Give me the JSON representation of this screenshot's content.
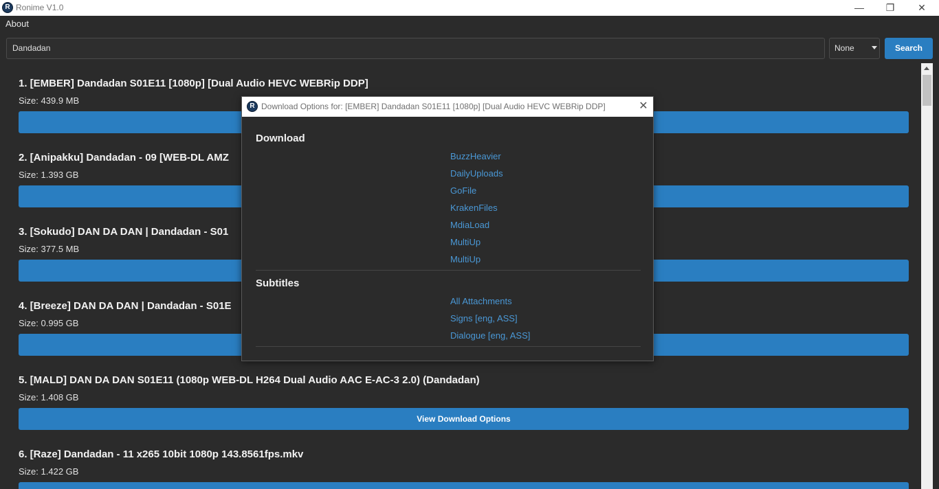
{
  "window": {
    "title": "Ronime V1.0",
    "logo_letter": "R",
    "minimize_glyph": "—",
    "maximize_glyph": "❐",
    "close_glyph": "✕"
  },
  "menu": {
    "about": "About"
  },
  "search": {
    "query": "Dandadan",
    "filter": "None",
    "button": "Search"
  },
  "results": [
    {
      "title": "1. [EMBER] Dandadan S01E11 [1080p] [Dual Audio HEVC WEBRip DDP]",
      "size": "Size: 439.9 MB",
      "button": ""
    },
    {
      "title": "2. [Anipakku] Dandadan - 09 [WEB-DL AMZ",
      "size": "Size: 1.393 GB",
      "button": ""
    },
    {
      "title": "3. [Sokudo] DAN DA DAN | Dandadan - S01",
      "size": "Size: 377.5 MB",
      "button": ""
    },
    {
      "title": "4. [Breeze] DAN DA DAN | Dandadan - S01E",
      "size": "Size: 0.995 GB",
      "button": ""
    },
    {
      "title": "5. [MALD] DAN DA DAN S01E11 (1080p WEB-DL H264 Dual Audio AAC E-AC-3 2.0) (Dandadan)",
      "size": "Size: 1.408 GB",
      "button": "View Download Options"
    },
    {
      "title": "6. [Raze] Dandadan - 11 x265 10bit 1080p 143.8561fps.mkv",
      "size": "Size: 1.422 GB",
      "button": ""
    }
  ],
  "dialog": {
    "title": "Download Options for: [EMBER] Dandadan S01E11 [1080p] [Dual Audio HEVC WEBRip DDP]",
    "close_glyph": "✕",
    "download_heading": "Download",
    "download_links": [
      "BuzzHeavier",
      "DailyUploads",
      "GoFile",
      "KrakenFiles",
      "MdiaLoad",
      "MultiUp",
      "MultiUp"
    ],
    "subtitles_heading": "Subtitles",
    "subtitle_links": [
      "All Attachments",
      "Signs [eng, ASS]",
      "Dialogue [eng, ASS]"
    ]
  },
  "colors": {
    "accent": "#2a7ec1",
    "background": "#2b2b2b",
    "link": "#4a98d6"
  }
}
